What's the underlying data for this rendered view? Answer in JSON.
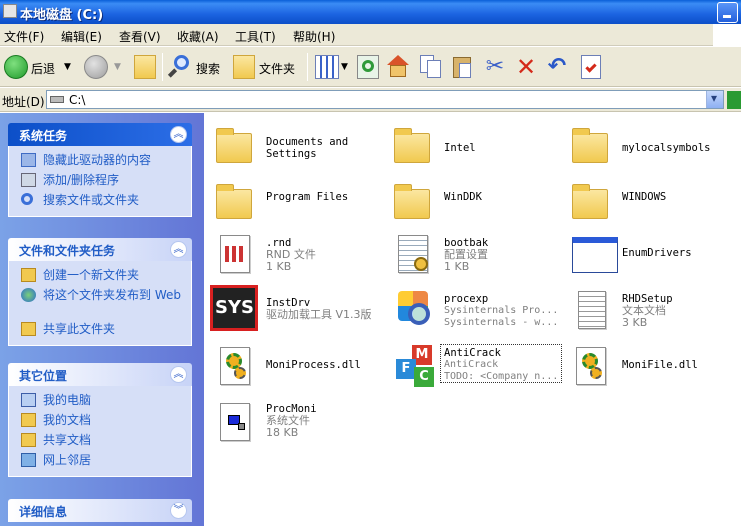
{
  "window": {
    "title": "本地磁盘 (C:)"
  },
  "menu": [
    {
      "label": "文件(F)"
    },
    {
      "label": "编辑(E)"
    },
    {
      "label": "查看(V)"
    },
    {
      "label": "收藏(A)"
    },
    {
      "label": "工具(T)"
    },
    {
      "label": "帮助(H)"
    }
  ],
  "toolbar": {
    "back_label": "后退",
    "search_label": "搜索",
    "folders_label": "文件夹"
  },
  "address": {
    "label": "地址(D)",
    "value": "C:\\"
  },
  "sidebar": {
    "panels": [
      {
        "title": "系统任务",
        "items": [
          {
            "label": "隐藏此驱动器的内容",
            "icon": "hide-drive-icon"
          },
          {
            "label": "添加/删除程序",
            "icon": "add-remove-programs-icon"
          },
          {
            "label": "搜索文件或文件夹",
            "icon": "search-icon"
          }
        ]
      },
      {
        "title": "文件和文件夹任务",
        "items": [
          {
            "label": "创建一个新文件夹",
            "icon": "new-folder-icon"
          },
          {
            "label": "将这个文件夹发布到 Web",
            "icon": "publish-web-icon"
          },
          {
            "label": "共享此文件夹",
            "icon": "share-folder-icon"
          }
        ]
      },
      {
        "title": "其它位置",
        "items": [
          {
            "label": "我的电脑",
            "icon": "my-computer-icon"
          },
          {
            "label": "我的文档",
            "icon": "my-documents-icon"
          },
          {
            "label": "共享文档",
            "icon": "shared-documents-icon"
          },
          {
            "label": "网上邻居",
            "icon": "network-places-icon"
          }
        ]
      },
      {
        "title": "详细信息",
        "items": []
      }
    ]
  },
  "files": [
    {
      "name": "Documents and\nSettings",
      "type": "folder"
    },
    {
      "name": "Intel",
      "type": "folder"
    },
    {
      "name": "mylocalsymbols",
      "type": "folder"
    },
    {
      "name": "Program Files",
      "type": "folder"
    },
    {
      "name": "WinDDK",
      "type": "folder"
    },
    {
      "name": "WINDOWS",
      "type": "folder"
    },
    {
      "name": ".rnd",
      "line2": "RND 文件",
      "line3": "1 KB",
      "type": "rnd"
    },
    {
      "name": "bootbak",
      "line2": "配置设置",
      "line3": "1 KB",
      "type": "config"
    },
    {
      "name": "EnumDrivers",
      "type": "window-app"
    },
    {
      "name": "InstDrv",
      "line2": "驱动加载工具 V1.3版",
      "type": "sys"
    },
    {
      "name": "procexp",
      "line2": "Sysinternals Pro...",
      "line3": "Sysinternals - w...",
      "type": "procexp"
    },
    {
      "name": "RHDSetup",
      "line2": "文本文档",
      "line3": "3 KB",
      "type": "text"
    },
    {
      "name": "MoniProcess.dll",
      "type": "dll"
    },
    {
      "name": "AntiCrack",
      "line2": "AntiCrack",
      "line3": "TODO: <Company n...",
      "type": "mfc",
      "selected": true
    },
    {
      "name": "MoniFile.dll",
      "type": "dll"
    },
    {
      "name": "ProcMoni",
      "line2": "系统文件",
      "line3": "18 KB",
      "type": "sysfile"
    }
  ]
}
